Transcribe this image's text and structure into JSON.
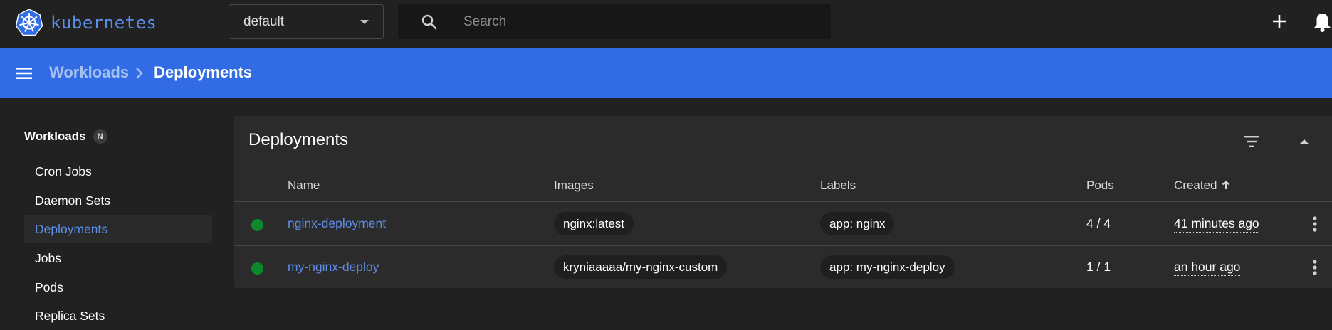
{
  "app": {
    "brand_name": "kubernetes",
    "accent_color": "#326ce5",
    "link_color": "#5d8ee9"
  },
  "toolbar": {
    "namespace_value": "default",
    "search_placeholder": "Search",
    "create_icon": "plus-icon",
    "notifications_icon": "bell-icon"
  },
  "breadcrumb": {
    "parent": "Workloads",
    "current": "Deployments"
  },
  "sidebar": {
    "group_label": "Workloads",
    "group_badge": "N",
    "items": [
      {
        "label": "Cron Jobs",
        "active": false
      },
      {
        "label": "Daemon Sets",
        "active": false
      },
      {
        "label": "Deployments",
        "active": true
      },
      {
        "label": "Jobs",
        "active": false
      },
      {
        "label": "Pods",
        "active": false
      },
      {
        "label": "Replica Sets",
        "active": false
      }
    ]
  },
  "deployments": {
    "title": "Deployments",
    "columns": {
      "name": "Name",
      "images": "Images",
      "labels": "Labels",
      "pods": "Pods",
      "created": "Created"
    },
    "sort": {
      "column": "Created",
      "direction": "ascending"
    },
    "rows": [
      {
        "status": "running",
        "status_color": "#0c8a2b",
        "name": "nginx-deployment",
        "image": "nginx:latest",
        "label": "app: nginx",
        "pods": "4 / 4",
        "created": "41 minutes ago"
      },
      {
        "status": "running",
        "status_color": "#0c8a2b",
        "name": "my-nginx-deploy",
        "image": "kryniaaaaa/my-nginx-custom",
        "label": "app: my-nginx-deploy",
        "pods": "1 / 1",
        "created": "an hour ago"
      }
    ]
  }
}
